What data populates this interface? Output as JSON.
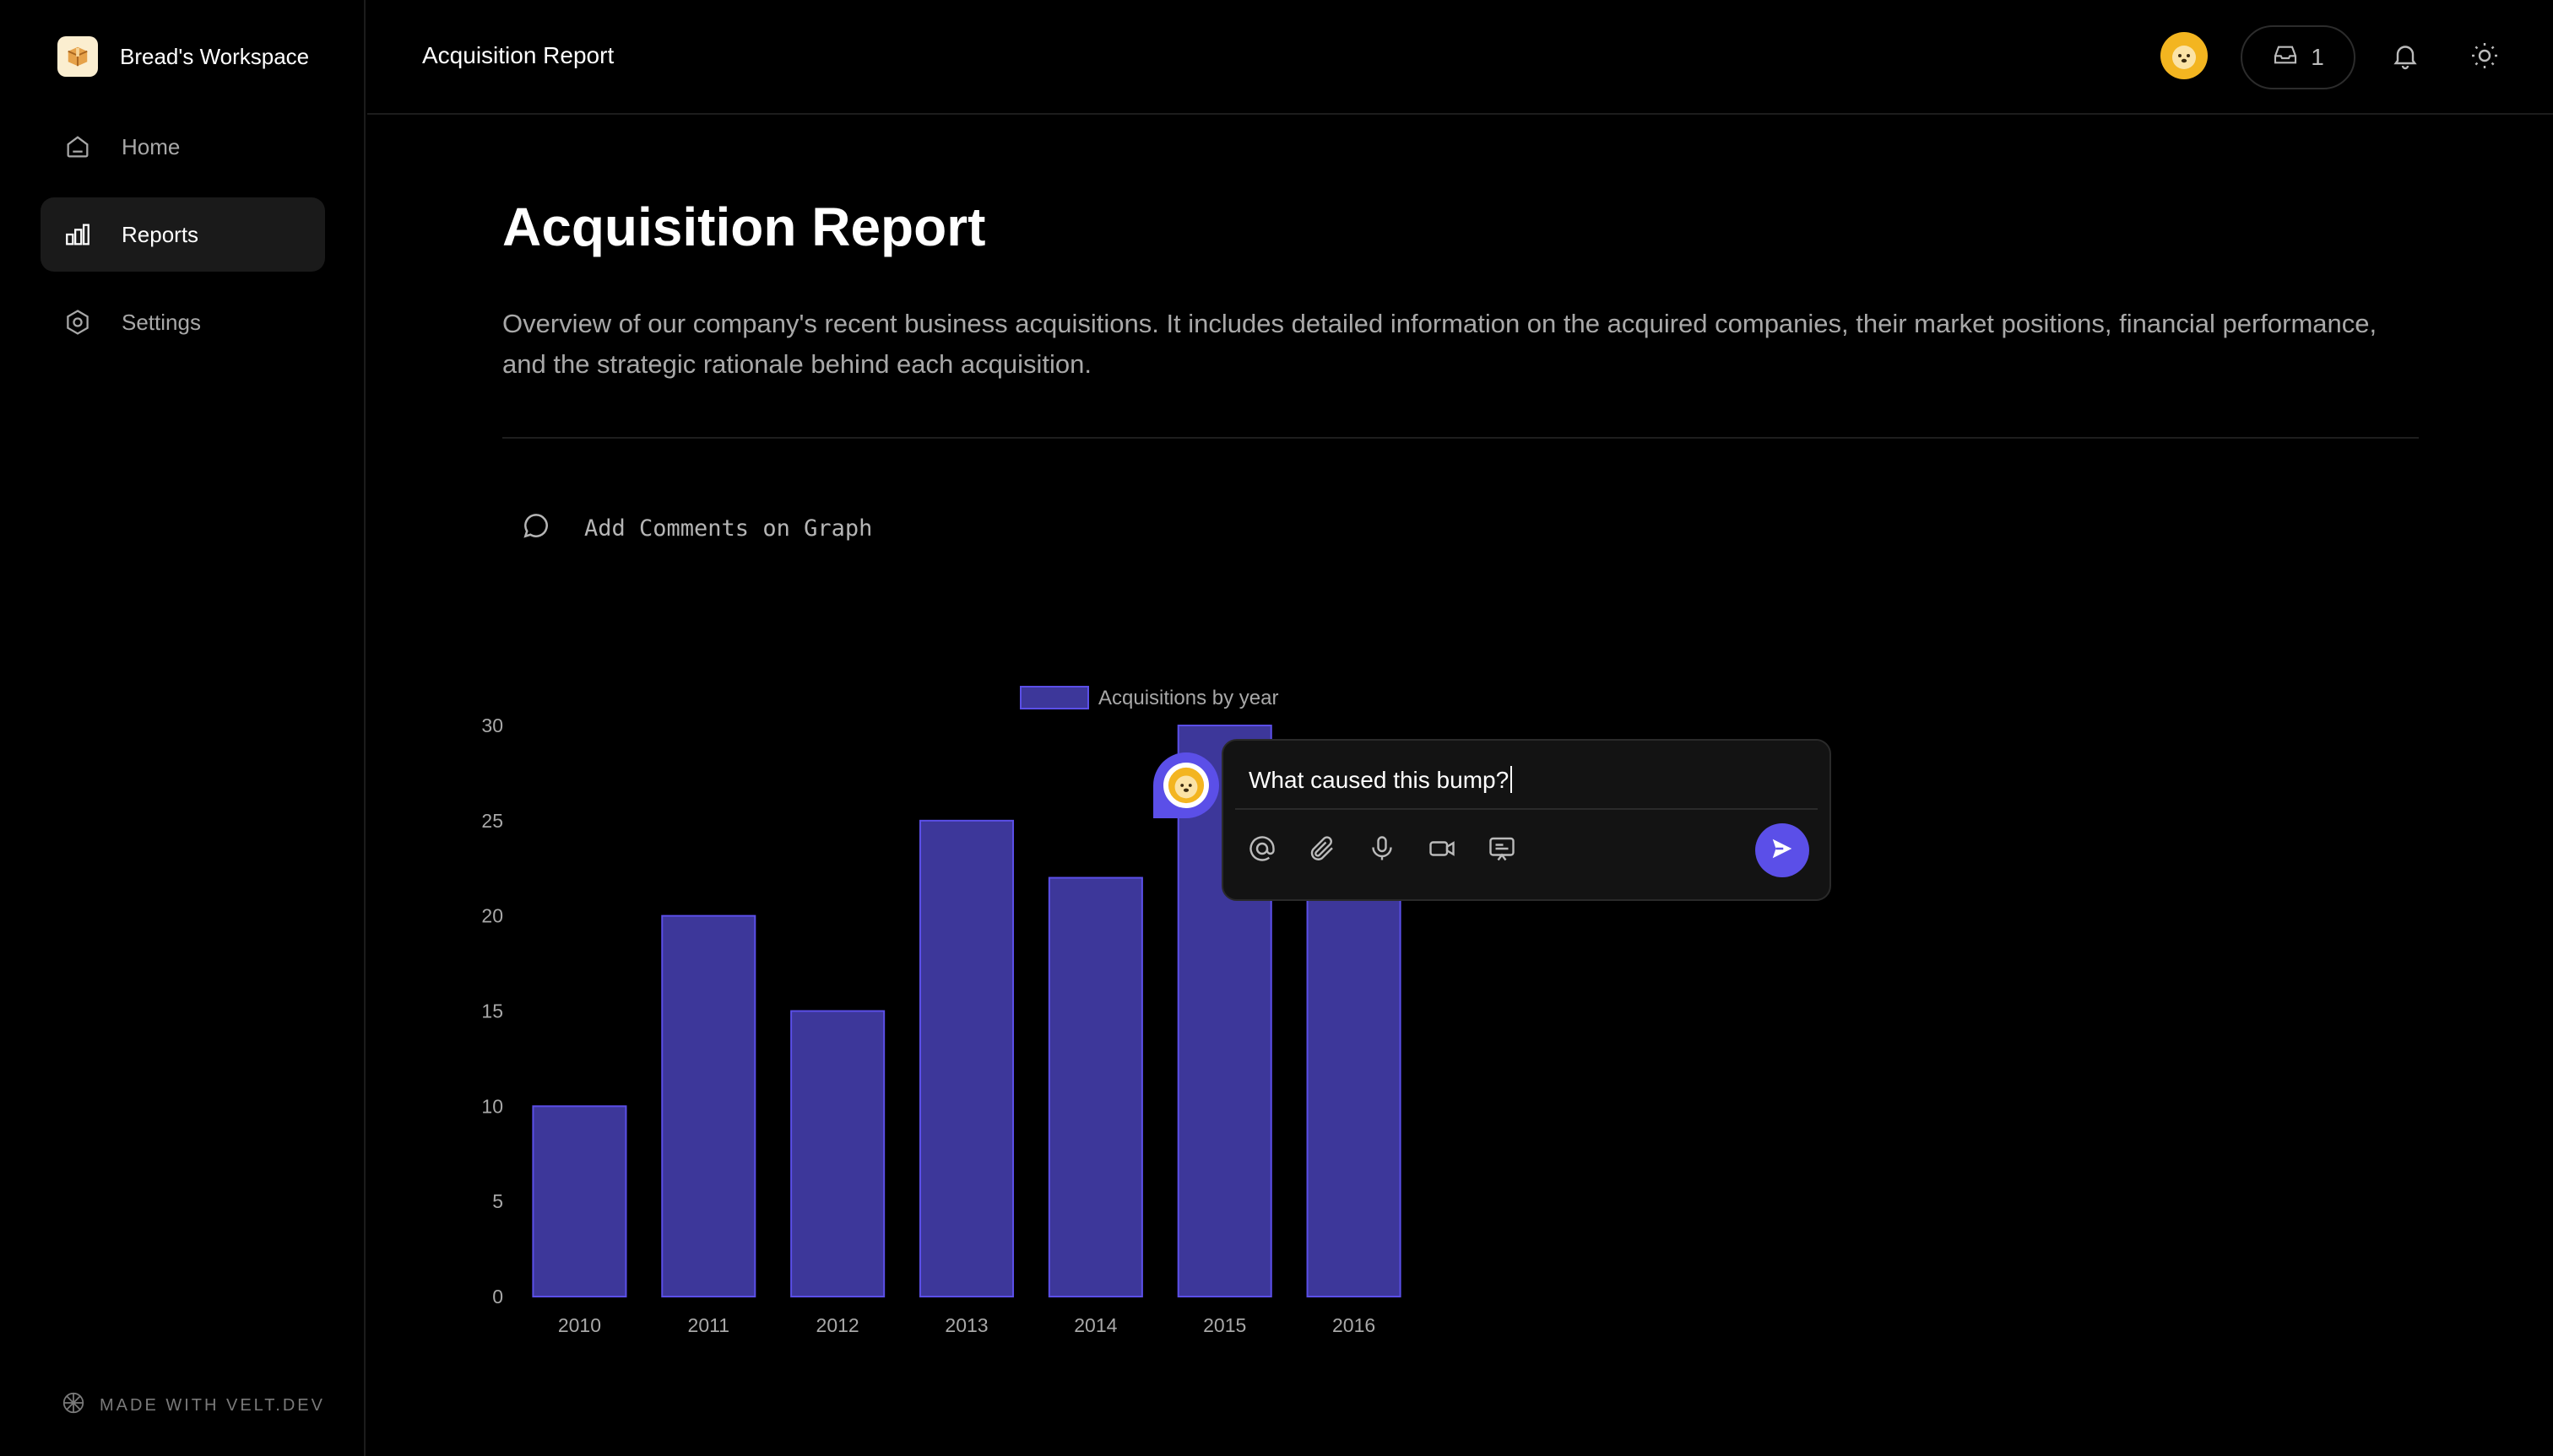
{
  "workspace": {
    "name": "Bread's Workspace",
    "logo_icon": "box-icon"
  },
  "sidebar": {
    "items": [
      {
        "label": "Home",
        "icon": "home-icon",
        "active": false
      },
      {
        "label": "Reports",
        "icon": "bar-chart-icon",
        "active": true
      },
      {
        "label": "Settings",
        "icon": "settings-icon",
        "active": false
      }
    ],
    "footer": "MADE WITH VELT.DEV"
  },
  "topbar": {
    "title": "Acquisition Report",
    "inbox_count": "1"
  },
  "page": {
    "title": "Acquisition Report",
    "description": "Overview of our company's recent business acquisitions. It includes detailed information on the acquired companies, their market positions, financial performance, and the strategic rationale behind each acquisition.",
    "add_comments_label": "Add Comments on Graph"
  },
  "comment": {
    "text": "What caused this bump?"
  },
  "colors": {
    "bar_fill": "#3d379a",
    "bar_stroke": "#5b4fe8",
    "accent": "#5b4fe8",
    "background": "#000000"
  },
  "chart_data": {
    "type": "bar",
    "categories": [
      "2010",
      "2011",
      "2012",
      "2013",
      "2014",
      "2015",
      "2016"
    ],
    "series": [
      {
        "name": "Acquisitions by year",
        "values": [
          10,
          20,
          15,
          25,
          22,
          30,
          28
        ]
      }
    ],
    "ylim": [
      0,
      30
    ],
    "yticks": [
      0,
      5,
      10,
      15,
      20,
      25,
      30
    ],
    "legend": "top-center",
    "grid": false
  }
}
